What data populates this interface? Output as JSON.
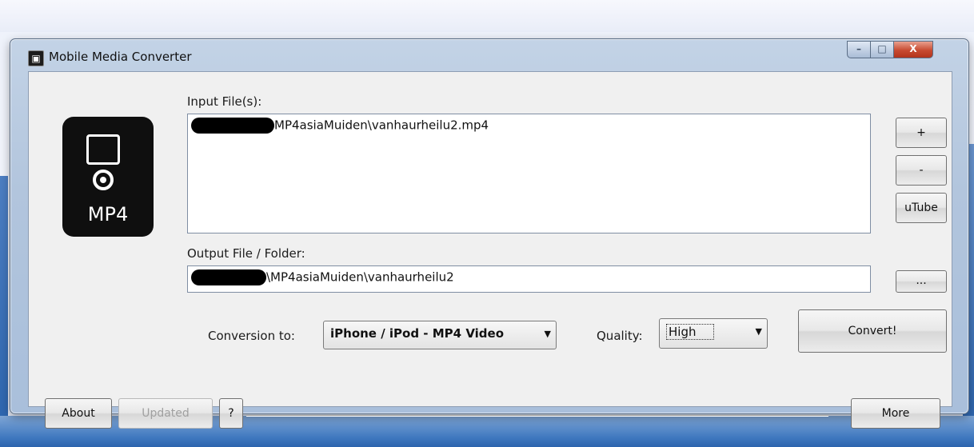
{
  "window": {
    "title": "Mobile Media Converter",
    "app_icon": "player-icon",
    "controls": {
      "minimize": "–",
      "maximize": "□",
      "close": "X"
    }
  },
  "logo": {
    "icon": "mp4-player-icon",
    "text": "MP4"
  },
  "input": {
    "label": "Input File(s):",
    "files": [
      "MP4asiaMuiden\\vanhaurheilu2.mp4"
    ]
  },
  "side_buttons": {
    "add": "+",
    "remove": "-",
    "utube": "uTube"
  },
  "output": {
    "label": "Output File / Folder:",
    "value": "\\MP4asiaMuiden\\vanhaurheilu2",
    "browse": "..."
  },
  "conversion": {
    "label": "Conversion to:",
    "selected": "iPhone / iPod - MP4 Video",
    "quality_label": "Quality:",
    "quality_selected": "High",
    "convert": "Convert!"
  },
  "footer": {
    "about": "About",
    "updated": "Updated",
    "help": "?",
    "more": "More"
  },
  "colors": {
    "title_bar": "#b2c5dd",
    "close_button": "#c74a31",
    "client_bg": "#f0f0f0"
  }
}
